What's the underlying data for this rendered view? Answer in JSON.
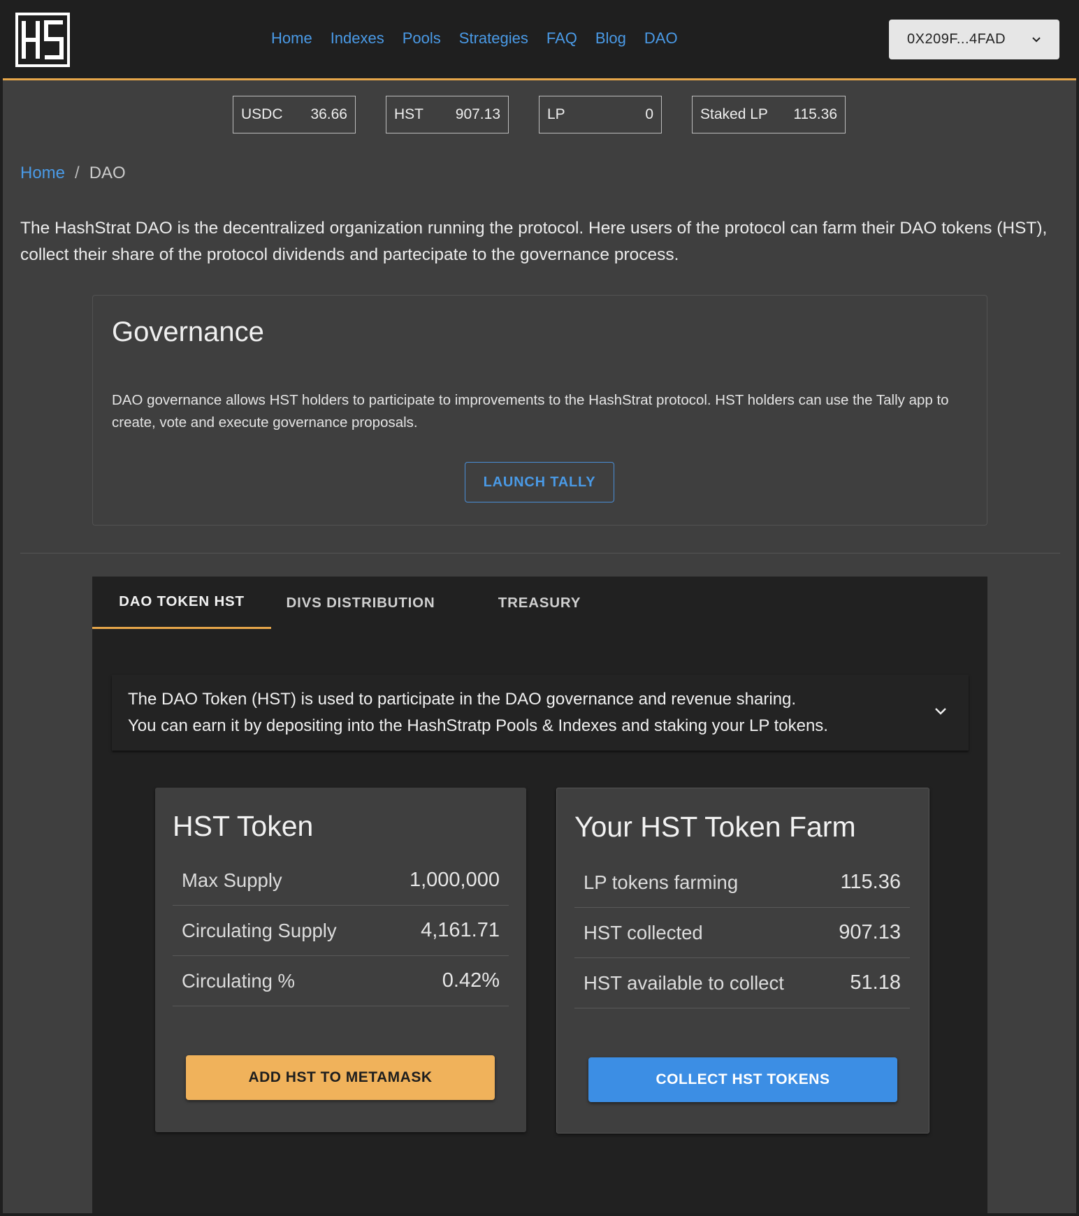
{
  "header": {
    "logo_text": "HS",
    "nav": [
      "Home",
      "Indexes",
      "Pools",
      "Strategies",
      "FAQ",
      "Blog",
      "DAO"
    ],
    "wallet_label": "0X209F...4FAD"
  },
  "balances": [
    {
      "label": "USDC",
      "value": "36.66"
    },
    {
      "label": "HST",
      "value": "907.13"
    },
    {
      "label": "LP",
      "value": "0"
    },
    {
      "label": "Staked LP",
      "value": "115.36"
    }
  ],
  "breadcrumb": {
    "home": "Home",
    "separator": "/",
    "current": "DAO"
  },
  "intro": "The HashStrat DAO is the decentralized organization running the protocol. Here users of the protocol can farm their DAO tokens (HST), collect their share of the protocol dividends and partecipate to the governance process.",
  "governance": {
    "title": "Governance",
    "text": "DAO governance allows HST holders to participate to improvements to the HashStrat protocol. HST holders can use the Tally app to create, vote and execute governance proposals.",
    "button": "LAUNCH TALLY"
  },
  "tabs": [
    "DAO TOKEN HST",
    "DIVS DISTRIBUTION",
    "TREASURY"
  ],
  "accordion": {
    "line1": "The DAO Token (HST) is used to participate in the DAO governance and revenue sharing.",
    "line2": "You can earn it by depositing into the HashStratp Pools & Indexes and staking your LP tokens."
  },
  "hst_token": {
    "title": "HST Token",
    "rows": [
      {
        "label": "Max Supply",
        "value": "1,000,000"
      },
      {
        "label": "Circulating Supply",
        "value": "4,161.71"
      },
      {
        "label": "Circulating %",
        "value": "0.42%"
      }
    ],
    "button": "ADD HST TO METAMASK"
  },
  "farm": {
    "title": "Your HST Token Farm",
    "rows": [
      {
        "label": "LP tokens farming",
        "value": "115.36"
      },
      {
        "label": "HST collected",
        "value": "907.13"
      },
      {
        "label": "HST available to collect",
        "value": "51.18"
      }
    ],
    "button": "COLLECT HST TOKENS"
  },
  "colors": {
    "accent": "#e6a64a",
    "link": "#4a9ae6",
    "orange_button": "#f0b25b",
    "blue_button": "#3c8ee4"
  }
}
